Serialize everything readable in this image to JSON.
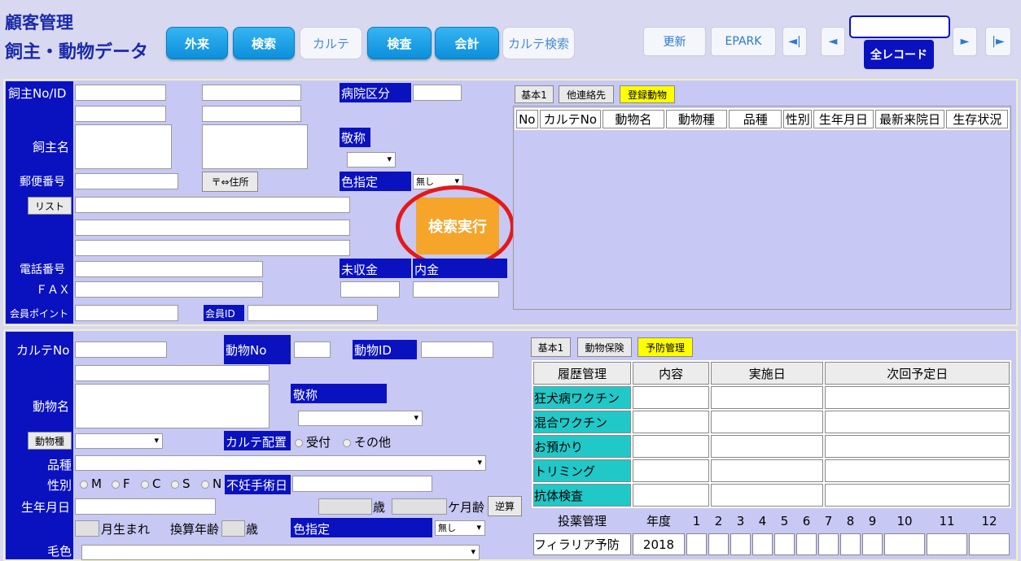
{
  "header": {
    "title1": "顧客管理",
    "title2": "飼主・動物データ",
    "search_btn": "全レコード"
  },
  "nav_buttons": [
    {
      "label": "外来"
    },
    {
      "label": "検索"
    },
    {
      "label": "カルテ"
    },
    {
      "label": "検査"
    },
    {
      "label": "会計"
    },
    {
      "label": "カルテ検索"
    },
    {
      "label": "更新"
    },
    {
      "label": "EPARK"
    }
  ],
  "nav_arrows": [
    "◄|",
    "◄",
    "►",
    "|►"
  ],
  "owner": {
    "labels": {
      "owner_no": "飼主No/ID",
      "name": "飼主名",
      "postal": "郵便番号",
      "phone": "電話番号",
      "fax": "ＦＡＸ",
      "points": "会員ポイント",
      "member_id": "会員ID",
      "hospital": "病院区分",
      "honorific": "敬称",
      "color": "色指定",
      "unpaid": "未収金",
      "breakdown": "内金"
    },
    "buttons": {
      "list": "リスト",
      "addr": "〒⇔住所",
      "search_exec": "検索実行"
    },
    "color_value": "無し",
    "tabs": [
      "基本1",
      "他連絡先",
      "登録動物"
    ],
    "table_headers": [
      "No",
      "カルテNo",
      "動物名",
      "動物種",
      "品種",
      "性別",
      "生年月日",
      "最新来院日",
      "生存状況"
    ]
  },
  "animal": {
    "labels": {
      "chart_no": "カルテNo",
      "animal_no": "動物No",
      "animal_id": "動物ID",
      "name": "動物名",
      "honorific": "敬称",
      "chart_place": "カルテ配置",
      "breed": "品種",
      "sex": "性別",
      "neuter": "不妊手術日",
      "birth": "生年月日",
      "age": "歳",
      "months": "ケ月齢",
      "born": "月生まれ",
      "conv_age": "換算年齢",
      "age2": "歳",
      "color": "色指定",
      "coat": "毛色"
    },
    "buttons": {
      "species": "動物種",
      "reverse": "逆算"
    },
    "chart_place_options": [
      "受付",
      "その他"
    ],
    "sex_options": [
      "M",
      "F",
      "C",
      "S",
      "N"
    ],
    "color_value": "無し",
    "tabs": [
      "基本1",
      "動物保険",
      "予防管理"
    ],
    "prev_headers": [
      "履歴管理",
      "内容",
      "実施日",
      "次回予定日"
    ],
    "prev_rows": [
      "狂犬病ワクチン",
      "混合ワクチン",
      "お預かり",
      "トリミング",
      "抗体検査"
    ],
    "med_headers": [
      "投薬管理",
      "年度",
      "1",
      "2",
      "3",
      "4",
      "5",
      "6",
      "7",
      "8",
      "9",
      "10",
      "11",
      "12"
    ],
    "med_rows": [
      {
        "name": "フィラリア予防",
        "year": "2018"
      }
    ]
  }
}
